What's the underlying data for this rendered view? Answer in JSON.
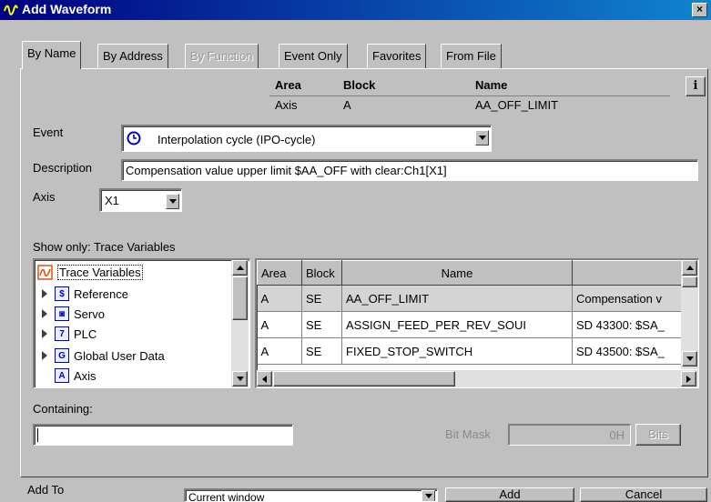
{
  "window": {
    "title": "Add Waveform",
    "close_glyph": "×"
  },
  "tabs": [
    {
      "label": "By Name",
      "active": true
    },
    {
      "label": "By Address"
    },
    {
      "label": "By Function",
      "disabled": true
    },
    {
      "label": "Event Only"
    },
    {
      "label": "Favorites"
    },
    {
      "label": "From File"
    }
  ],
  "info_button": {
    "label": "i"
  },
  "selected": {
    "headers": {
      "area": "Area",
      "block": "Block",
      "name": "Name"
    },
    "area": "Axis",
    "block": "A",
    "name": "AA_OFF_LIMIT"
  },
  "event": {
    "label": "Event",
    "value": "Interpolation cycle (IPO-cycle)",
    "icon": "clock-icon"
  },
  "description": {
    "label": "Description",
    "value": "Compensation value upper limit  $AA_OFF with clear:Ch1[X1]"
  },
  "axis": {
    "label": "Axis",
    "value": "X1"
  },
  "show_only": {
    "label": "Show only: Trace Variables"
  },
  "tree": {
    "items": [
      {
        "label": "Trace Variables",
        "icon": "trace-icon",
        "glyph": ""
      },
      {
        "label": "Reference",
        "icon": "reference-icon",
        "glyph": "$"
      },
      {
        "label": "Servo",
        "icon": "servo-icon",
        "glyph": "◙"
      },
      {
        "label": "PLC",
        "icon": "plc-icon",
        "glyph": "7"
      },
      {
        "label": "Global User Data",
        "icon": "global-user-data-icon",
        "glyph": "G"
      },
      {
        "label": "Axis",
        "icon": "axis-icon",
        "glyph": "A"
      }
    ]
  },
  "grid": {
    "columns": [
      "Area",
      "Block",
      "Name",
      ""
    ],
    "rows": [
      {
        "area": "A",
        "block": "SE",
        "name": "AA_OFF_LIMIT",
        "desc": "Compensation v"
      },
      {
        "area": "A",
        "block": "SE",
        "name": "ASSIGN_FEED_PER_REV_SOUI",
        "desc": "SD 43300: $SA_"
      },
      {
        "area": "A",
        "block": "SE",
        "name": "FIXED_STOP_SWITCH",
        "desc": "SD 43500: $SA_"
      }
    ]
  },
  "containing": {
    "label": "Containing:",
    "value": ""
  },
  "bitmask": {
    "label": "Bit Mask",
    "value": "0H",
    "button": "Bits"
  },
  "add_to": {
    "label": "Add To",
    "value": "Current window"
  },
  "buttons": {
    "add": "Add",
    "cancel": "Cancel"
  },
  "colors": {
    "title_start": "#000080",
    "title_end": "#1084d0",
    "face": "#c0c0c0",
    "icon_blue": "#0000c0",
    "trace_orange": "#e05010"
  }
}
